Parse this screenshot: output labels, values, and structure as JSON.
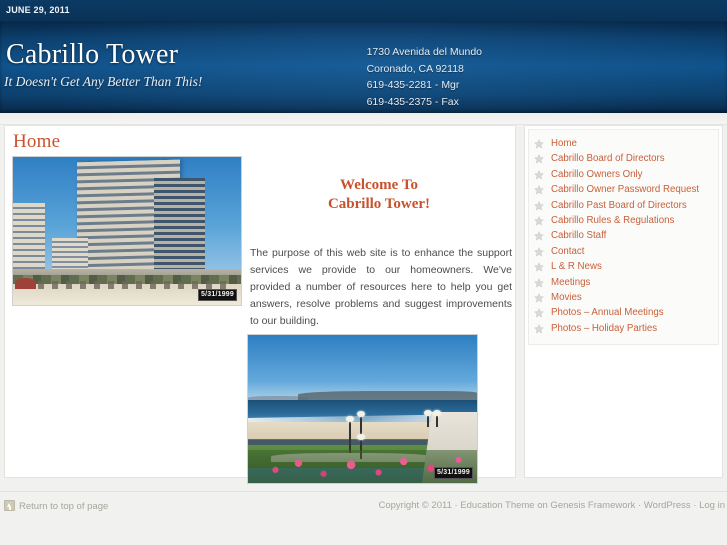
{
  "topbar": {
    "date": "JUNE 29, 2011"
  },
  "header": {
    "site_title": "Cabrillo Tower",
    "site_description": "It Doesn't Get Any Better Than This!",
    "contact": {
      "address_line1": "1730 Avenida del Mundo",
      "address_line2": "Coronado, CA 92118",
      "phone_manager": "619-435-2281 - Mgr",
      "phone_fax": "619-435-2375 - Fax"
    }
  },
  "content": {
    "page_title": "Home",
    "welcome_heading_line1": "Welcome To",
    "welcome_heading_line2": "Cabrillo Tower!",
    "body_text": "The purpose of this web site is to enhance the support services we provide to our homeowners. We've provided a number of resources here to help you get answers, resolve problems and suggest improvements to our building.",
    "photo_building": {
      "alt": "Cabrillo Tower high-rise building viewed from the beach",
      "datestamp": "5/31/1999"
    },
    "photo_beach": {
      "alt": "Coronado beach and ocean view with flowers in foreground",
      "datestamp": "5/31/1999"
    }
  },
  "sidebar": {
    "bullet_icon": "star-icon",
    "items": [
      {
        "label": "Home"
      },
      {
        "label": "Cabrillo Board of Directors"
      },
      {
        "label": "Cabrillo Owners Only"
      },
      {
        "label": "Cabrillo Owner Password Request"
      },
      {
        "label": "Cabrillo Past Board of Directors"
      },
      {
        "label": "Cabrillo Rules & Regulations"
      },
      {
        "label": "Cabrillo Staff"
      },
      {
        "label": "Contact"
      },
      {
        "label": "L & R News"
      },
      {
        "label": "Meetings"
      },
      {
        "label": "Movies"
      },
      {
        "label": "Photos – Annual Meetings"
      },
      {
        "label": "Photos – Holiday Parties"
      }
    ]
  },
  "footer": {
    "return_top_label": "Return to top of page",
    "return_top_icon": "up-arrow-icon",
    "credits": "Copyright © 2011 · Education Theme on Genesis Framework · WordPress · Log in"
  },
  "colors": {
    "header_blue": "#10538c",
    "topbar_blue": "#0a3257",
    "accent_orange": "#c8522c",
    "link_orange": "#c8603a",
    "page_bg": "#f1f1ef",
    "body_text": "#4c4c4c",
    "footer_text": "#a6a69e"
  }
}
